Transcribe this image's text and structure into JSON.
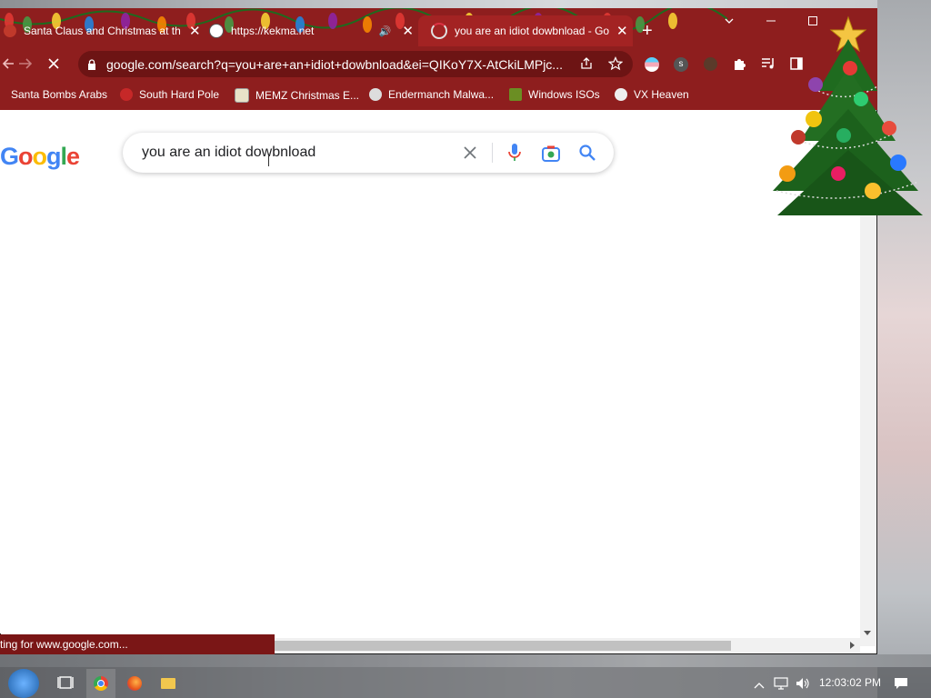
{
  "tabs": [
    {
      "title": "Santa Claus and Christmas at th",
      "close": "✕"
    },
    {
      "title": "https://kekma.net",
      "close": "✕"
    },
    {
      "title": "you are an idiot dowbnload - Go",
      "close": "✕"
    }
  ],
  "new_tab": "+",
  "address": {
    "url": "google.com/search?q=you+are+an+idiot+dowbnload&ei=QIKoY7X-AtCkiLMPjc..."
  },
  "bookmarks": [
    {
      "label": "Santa Bombs Arabs"
    },
    {
      "label": "South Hard Pole"
    },
    {
      "label": "MEMZ Christmas E..."
    },
    {
      "label": "Endermanch Malwa..."
    },
    {
      "label": "Windows ISOs"
    },
    {
      "label": "VX Heaven"
    }
  ],
  "google": {
    "logo": "Google",
    "query": "you are an idiot dowbnload"
  },
  "status_text": "ting for www.google.com...",
  "taskbar": {
    "clock": "12:03:02 PM"
  },
  "colors": {
    "chrome_red": "#8e1e1e",
    "google_blue": "#4285f4",
    "google_red": "#ea4335",
    "google_yellow": "#fbbc05",
    "google_green": "#34a853"
  }
}
